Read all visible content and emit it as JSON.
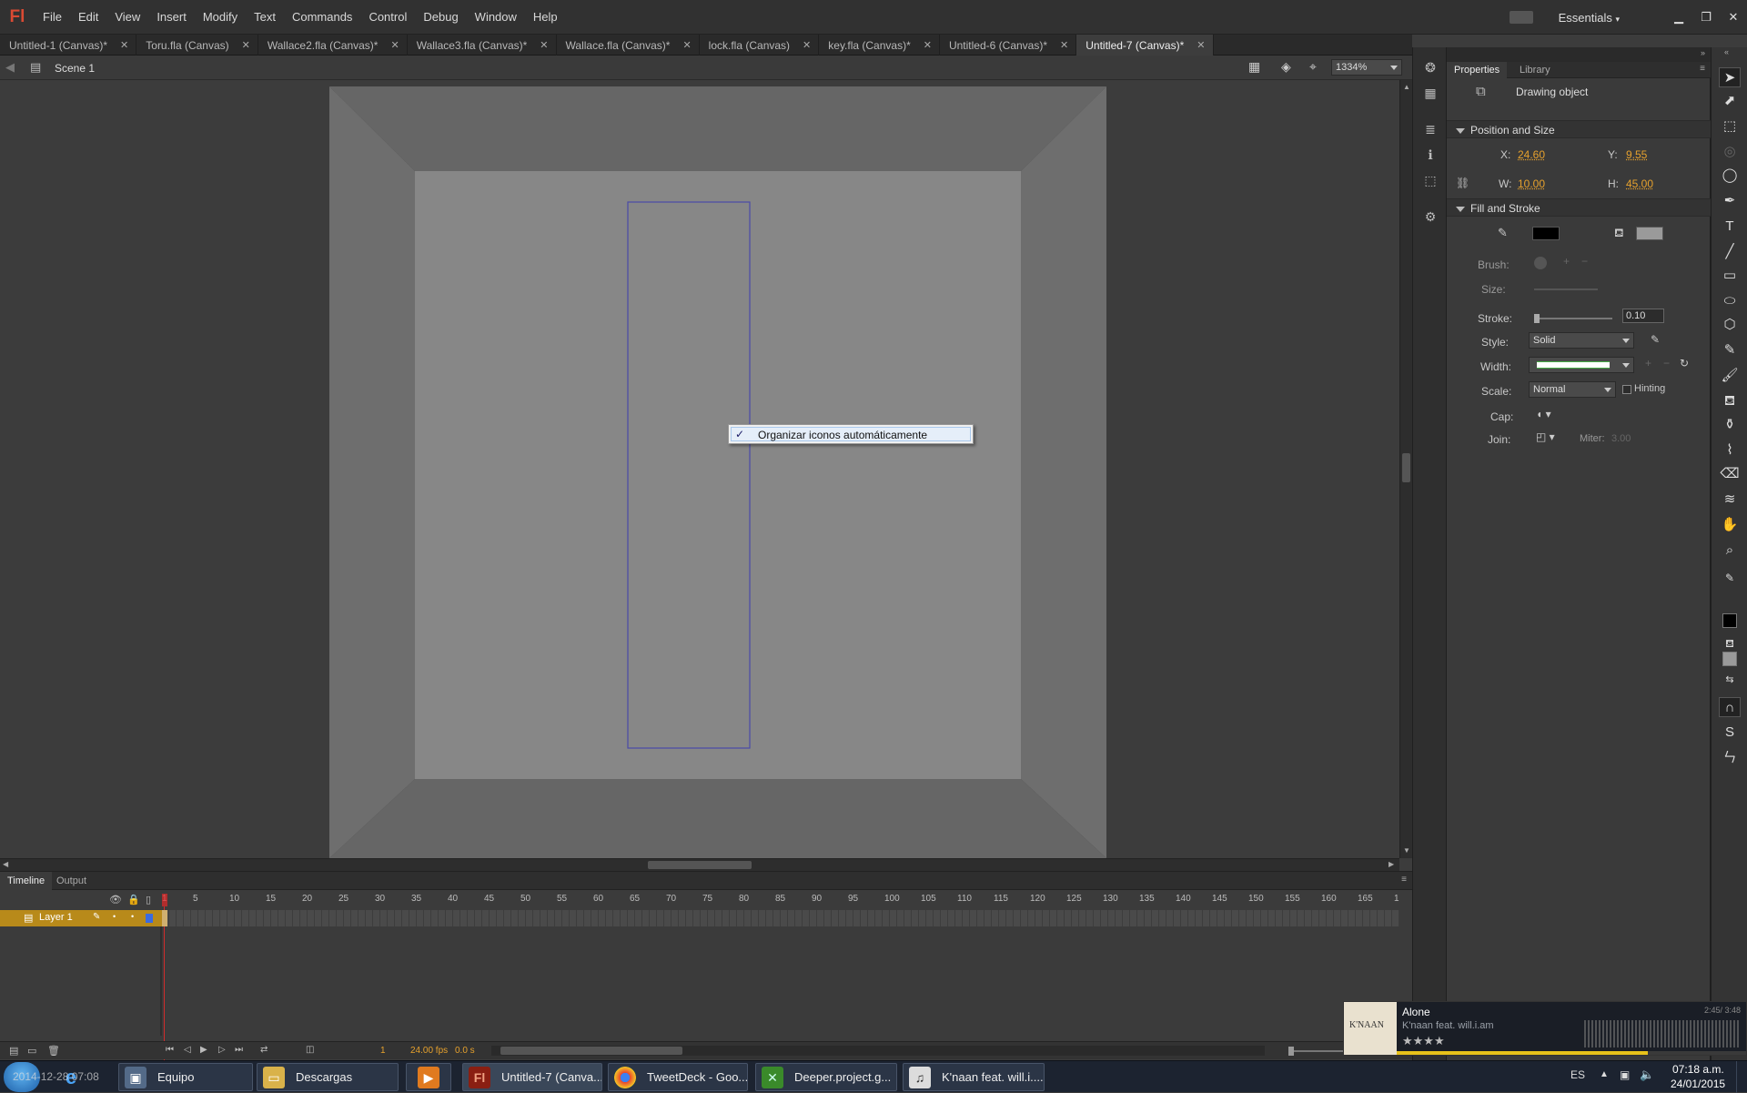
{
  "app": {
    "logo": "Fl"
  },
  "menu": [
    "File",
    "Edit",
    "View",
    "Insert",
    "Modify",
    "Text",
    "Commands",
    "Control",
    "Debug",
    "Window",
    "Help"
  ],
  "workspace": {
    "label": "Essentials"
  },
  "tabs": [
    {
      "label": "Untitled-1 (Canvas)*"
    },
    {
      "label": "Toru.fla (Canvas)"
    },
    {
      "label": "Wallace2.fla (Canvas)*"
    },
    {
      "label": "Wallace3.fla (Canvas)*"
    },
    {
      "label": "Wallace.fla (Canvas)*"
    },
    {
      "label": "lock.fla (Canvas)"
    },
    {
      "label": "key.fla (Canvas)*"
    },
    {
      "label": "Untitled-6 (Canvas)*"
    },
    {
      "label": "Untitled-7 (Canvas)*"
    }
  ],
  "editbar": {
    "scene": "Scene 1",
    "zoom": "1334%"
  },
  "context_menu": {
    "check": "✓",
    "item": "Organizar iconos automáticamente"
  },
  "timeline": {
    "tabs": [
      "Timeline",
      "Output"
    ],
    "layer": "Layer 1",
    "frames": [
      "1",
      "5",
      "10",
      "15",
      "20",
      "25",
      "30",
      "35",
      "40",
      "45",
      "50",
      "55",
      "60",
      "65",
      "70",
      "75",
      "80",
      "85",
      "90",
      "95",
      "100",
      "105",
      "110",
      "115",
      "120",
      "125",
      "130",
      "135",
      "140",
      "145",
      "150",
      "155",
      "160",
      "165",
      "1"
    ],
    "current_frame": "1",
    "fps": "24.00 fps",
    "time": "0.0 s"
  },
  "panel": {
    "tabs": [
      "Properties",
      "Library"
    ],
    "object_type": "Drawing object",
    "pos_section": "Position and Size",
    "x_label": "X:",
    "x": "24.60",
    "y_label": "Y:",
    "y": "9.55",
    "w_label": "W:",
    "w": "10.00",
    "h_label": "H:",
    "h": "45.00",
    "fill_section": "Fill and Stroke",
    "brush_label": "Brush:",
    "size_label": "Size:",
    "stroke_label": "Stroke:",
    "stroke": "0.10",
    "style_label": "Style:",
    "style": "Solid",
    "width_label": "Width:",
    "scale_label": "Scale:",
    "scale": "Normal",
    "hinting_label": "Hinting",
    "cap_label": "Cap:",
    "join_label": "Join:",
    "miter_label": "Miter:",
    "miter": "3.00"
  },
  "media": {
    "title": "Alone",
    "artist": "K'naan feat. will.i.am",
    "time": "2:45/ 3:48",
    "album_art_text": "K'NAAN"
  },
  "taskbar": {
    "tasks": [
      {
        "label": "Equipo"
      },
      {
        "label": "Descargas"
      },
      {
        "label": ""
      },
      {
        "label": "Untitled-7 (Canva..."
      },
      {
        "label": "TweetDeck - Goo..."
      },
      {
        "label": "Deeper.project.g..."
      },
      {
        "label": "K'naan feat. will.i...."
      }
    ],
    "overlay_text": "2014-12-28 07:08",
    "lang": "ES",
    "clock_time": "07:18 a.m.",
    "clock_date": "24/01/2015"
  },
  "colors": {
    "accent": "#e6a12d",
    "layer_row": "#b88a1a",
    "playhead": "#d12b2b",
    "selection": "#4a4aa8"
  }
}
